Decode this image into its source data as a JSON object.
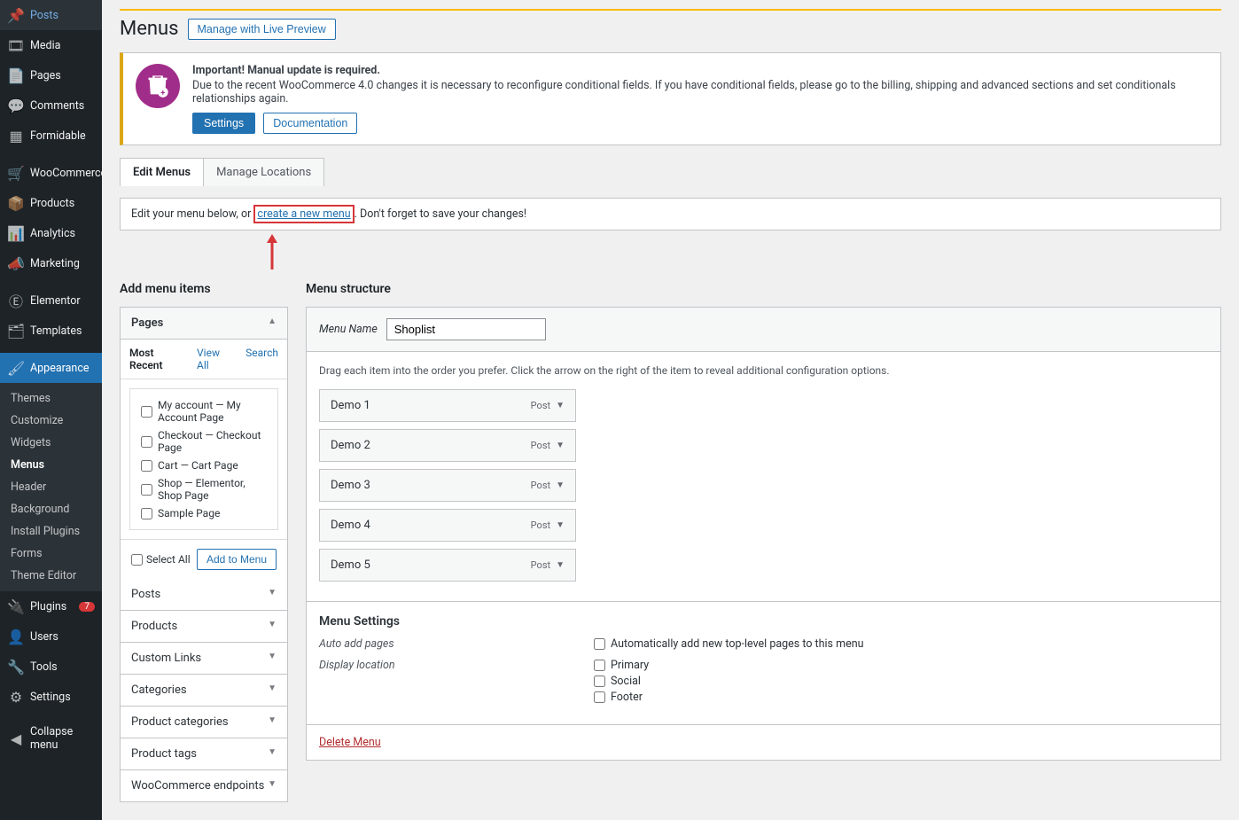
{
  "sidebar": {
    "items": [
      {
        "icon": "📌",
        "label": "Posts"
      },
      {
        "icon": "🎞",
        "label": "Media"
      },
      {
        "icon": "📄",
        "label": "Pages"
      },
      {
        "icon": "💬",
        "label": "Comments"
      },
      {
        "icon": "▦",
        "label": "Formidable"
      },
      {
        "icon": "🛒",
        "label": "WooCommerce"
      },
      {
        "icon": "📦",
        "label": "Products"
      },
      {
        "icon": "📊",
        "label": "Analytics"
      },
      {
        "icon": "📣",
        "label": "Marketing"
      },
      {
        "icon": "Ⓔ",
        "label": "Elementor"
      },
      {
        "icon": "🗂",
        "label": "Templates"
      },
      {
        "icon": "🖌",
        "label": "Appearance"
      },
      {
        "icon": "🔌",
        "label": "Plugins",
        "badge": "7"
      },
      {
        "icon": "👤",
        "label": "Users"
      },
      {
        "icon": "🔧",
        "label": "Tools"
      },
      {
        "icon": "⚙",
        "label": "Settings"
      }
    ],
    "appearance_submenu": [
      "Themes",
      "Customize",
      "Widgets",
      "Menus",
      "Header",
      "Background",
      "Install Plugins",
      "Forms",
      "Theme Editor"
    ],
    "collapse": "Collapse menu"
  },
  "page": {
    "title": "Menus",
    "manage_btn": "Manage with Live Preview"
  },
  "notice": {
    "title": "Important! Manual update is required.",
    "text": "Due to the recent WooCommerce 4.0 changes it is necessary to reconfigure conditional fields. If you have conditional fields, please go to the billing, shipping and advanced sections and set conditionals relationships again.",
    "settings_btn": "Settings",
    "docs_btn": "Documentation"
  },
  "tabs": [
    "Edit Menus",
    "Manage Locations"
  ],
  "info_bar": {
    "before": "Edit your menu below, or ",
    "link": "create a new menu",
    "after": ". Don't forget to save your changes!"
  },
  "add_items": {
    "title": "Add menu items",
    "panels": [
      "Pages",
      "Posts",
      "Products",
      "Custom Links",
      "Categories",
      "Product categories",
      "Product tags",
      "WooCommerce endpoints"
    ],
    "subtabs": [
      "Most Recent",
      "View All",
      "Search"
    ],
    "pages": [
      "My account — My Account Page",
      "Checkout — Checkout Page",
      "Cart — Cart Page",
      "Shop — Elementor, Shop Page",
      "Sample Page"
    ],
    "select_all": "Select All",
    "add_btn": "Add to Menu"
  },
  "structure": {
    "title": "Menu structure",
    "name_label": "Menu Name",
    "name_value": "Shoplist",
    "hint": "Drag each item into the order you prefer. Click the arrow on the right of the item to reveal additional configuration options.",
    "items": [
      {
        "label": "Demo 1",
        "type": "Post"
      },
      {
        "label": "Demo 2",
        "type": "Post"
      },
      {
        "label": "Demo 3",
        "type": "Post"
      },
      {
        "label": "Demo 4",
        "type": "Post"
      },
      {
        "label": "Demo 5",
        "type": "Post"
      }
    ],
    "settings_title": "Menu Settings",
    "auto_add_label": "Auto add pages",
    "auto_add_opt": "Automatically add new top-level pages to this menu",
    "display_label": "Display location",
    "locations": [
      "Primary",
      "Social",
      "Footer"
    ],
    "delete": "Delete Menu"
  }
}
